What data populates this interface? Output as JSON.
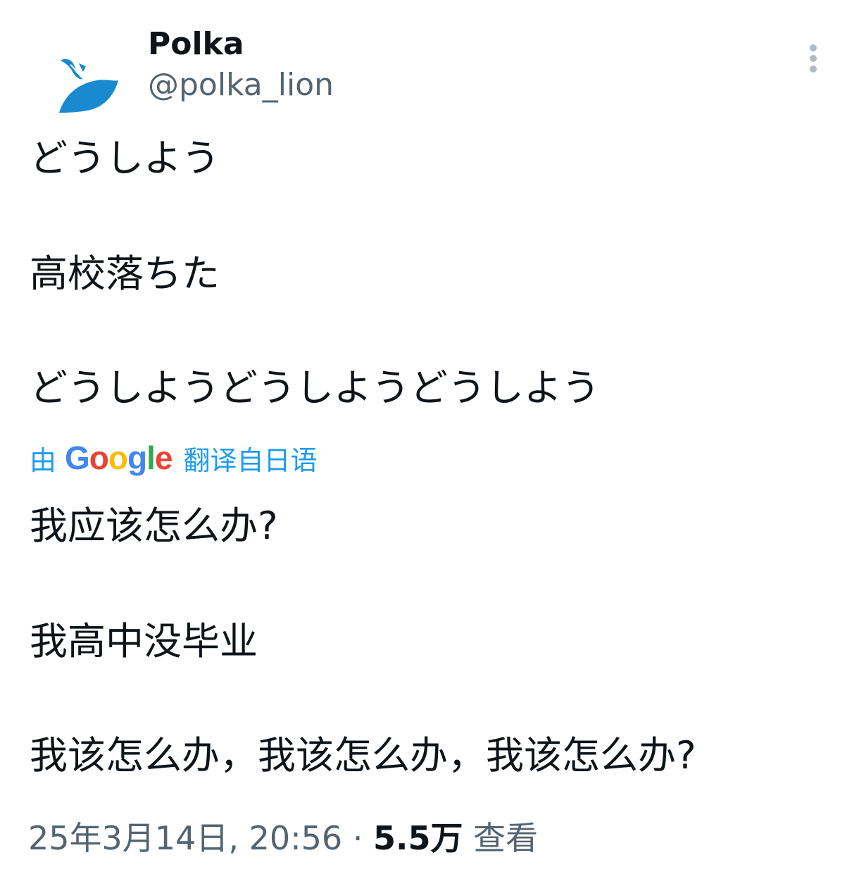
{
  "author": {
    "display_name": "Polka",
    "handle": "@polka_lion",
    "avatar_icon": "blue-bird-avatar-icon"
  },
  "menu": {
    "icon": "more-vertical-icon"
  },
  "original_text": [
    "どうしよう",
    "高校落ちた",
    "どうしようどうしようどうしよう"
  ],
  "translation": {
    "prefix": "由",
    "google_letters": [
      "G",
      "o",
      "o",
      "g",
      "l",
      "e"
    ],
    "google_colors": [
      "#4285F4",
      "#EA4335",
      "#FBBC05",
      "#4285F4",
      "#34A853",
      "#EA4335"
    ],
    "suffix": "翻译自日语",
    "accent_color": "#1d9bf0"
  },
  "translated_text": [
    "我应该怎么办?",
    "我高中没毕业",
    "我该怎么办，我该怎么办，我该怎么办?"
  ],
  "meta": {
    "timestamp": "25年3月14日, 20:56",
    "separator": "·",
    "views_count": "5.5万",
    "views_label": "查看"
  }
}
